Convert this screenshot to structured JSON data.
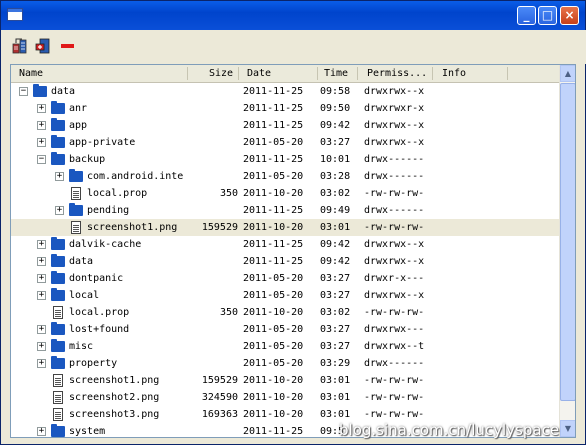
{
  "window": {
    "minimize_label": "_",
    "maximize_label": "□",
    "close_label": "×"
  },
  "columns": {
    "name": "Name",
    "size": "Size",
    "date": "Date",
    "time": "Time",
    "perm": "Permiss...",
    "info": "Info"
  },
  "rows": [
    {
      "name": "data",
      "size": "",
      "date": "2011-11-25",
      "time": "09:58",
      "perm": "drwxrwx--x",
      "type": "folder",
      "level": 0,
      "expander": "−"
    },
    {
      "name": "anr",
      "size": "",
      "date": "2011-11-25",
      "time": "09:50",
      "perm": "drwxrwxr-x",
      "type": "folder",
      "level": 1,
      "expander": "+"
    },
    {
      "name": "app",
      "size": "",
      "date": "2011-11-25",
      "time": "09:42",
      "perm": "drwxrwx--x",
      "type": "folder",
      "level": 1,
      "expander": "+"
    },
    {
      "name": "app-private",
      "size": "",
      "date": "2011-05-20",
      "time": "03:27",
      "perm": "drwxrwx--x",
      "type": "folder",
      "level": 1,
      "expander": "+"
    },
    {
      "name": "backup",
      "size": "",
      "date": "2011-11-25",
      "time": "10:01",
      "perm": "drwx------",
      "type": "folder",
      "level": 1,
      "expander": "−"
    },
    {
      "name": "com.android.inte",
      "size": "",
      "date": "2011-05-20",
      "time": "03:28",
      "perm": "drwx------",
      "type": "folder",
      "level": 2,
      "expander": "+"
    },
    {
      "name": "local.prop",
      "size": "350",
      "date": "2011-10-20",
      "time": "03:02",
      "perm": "-rw-rw-rw-",
      "type": "file",
      "level": 2,
      "expander": ""
    },
    {
      "name": "pending",
      "size": "",
      "date": "2011-11-25",
      "time": "09:49",
      "perm": "drwx------",
      "type": "folder",
      "level": 2,
      "expander": "+"
    },
    {
      "name": "screenshot1.png",
      "size": "159529",
      "date": "2011-10-20",
      "time": "03:01",
      "perm": "-rw-rw-rw-",
      "type": "file",
      "level": 2,
      "expander": "",
      "selected": true
    },
    {
      "name": "dalvik-cache",
      "size": "",
      "date": "2011-11-25",
      "time": "09:42",
      "perm": "drwxrwx--x",
      "type": "folder",
      "level": 1,
      "expander": "+"
    },
    {
      "name": "data",
      "size": "",
      "date": "2011-11-25",
      "time": "09:42",
      "perm": "drwxrwx--x",
      "type": "folder",
      "level": 1,
      "expander": "+"
    },
    {
      "name": "dontpanic",
      "size": "",
      "date": "2011-05-20",
      "time": "03:27",
      "perm": "drwxr-x---",
      "type": "folder",
      "level": 1,
      "expander": "+"
    },
    {
      "name": "local",
      "size": "",
      "date": "2011-05-20",
      "time": "03:27",
      "perm": "drwxrwx--x",
      "type": "folder",
      "level": 1,
      "expander": "+"
    },
    {
      "name": "local.prop",
      "size": "350",
      "date": "2011-10-20",
      "time": "03:02",
      "perm": "-rw-rw-rw-",
      "type": "file",
      "level": 1,
      "expander": ""
    },
    {
      "name": "lost+found",
      "size": "",
      "date": "2011-05-20",
      "time": "03:27",
      "perm": "drwxrwx---",
      "type": "folder",
      "level": 1,
      "expander": "+"
    },
    {
      "name": "misc",
      "size": "",
      "date": "2011-05-20",
      "time": "03:27",
      "perm": "drwxrwx--t",
      "type": "folder",
      "level": 1,
      "expander": "+"
    },
    {
      "name": "property",
      "size": "",
      "date": "2011-05-20",
      "time": "03:29",
      "perm": "drwx------",
      "type": "folder",
      "level": 1,
      "expander": "+"
    },
    {
      "name": "screenshot1.png",
      "size": "159529",
      "date": "2011-10-20",
      "time": "03:01",
      "perm": "-rw-rw-rw-",
      "type": "file",
      "level": 1,
      "expander": ""
    },
    {
      "name": "screenshot2.png",
      "size": "324590",
      "date": "2011-10-20",
      "time": "03:01",
      "perm": "-rw-rw-rw-",
      "type": "file",
      "level": 1,
      "expander": ""
    },
    {
      "name": "screenshot3.png",
      "size": "169363",
      "date": "2011-10-20",
      "time": "03:01",
      "perm": "-rw-rw-rw-",
      "type": "file",
      "level": 1,
      "expander": ""
    },
    {
      "name": "system",
      "size": "",
      "date": "2011-11-25",
      "time": "09:5",
      "perm": "",
      "type": "folder",
      "level": 1,
      "expander": "+"
    }
  ],
  "scrollbar": {
    "up": "▲",
    "down": "▼"
  },
  "watermark": "blog.sina.com.cn/lucylyspace",
  "colors": {
    "titlebar": "#0a5de8",
    "selected_row": "#ece9d8",
    "folder": "#1a57c0"
  },
  "icons": [
    "screen-capture-icon",
    "push-file-icon",
    "delete-icon"
  ]
}
